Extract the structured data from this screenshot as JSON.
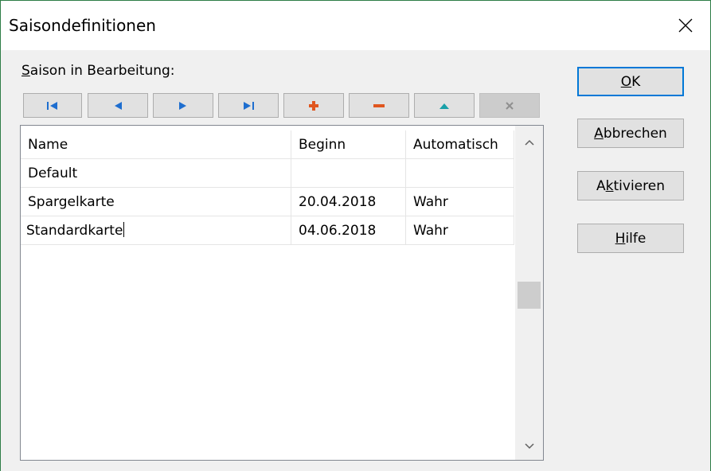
{
  "window": {
    "title": "Saisondefinitionen"
  },
  "label_saison": "Saison in Bearbeitung:",
  "nav_buttons": [
    {
      "name": "first-record",
      "icon": "first-record-icon",
      "color": "#1e6ecf",
      "enabled": true
    },
    {
      "name": "prior-record",
      "icon": "prior-record-icon",
      "color": "#1e6ecf",
      "enabled": true
    },
    {
      "name": "next-record",
      "icon": "next-record-icon",
      "color": "#1e6ecf",
      "enabled": true
    },
    {
      "name": "last-record",
      "icon": "last-record-icon",
      "color": "#1e6ecf",
      "enabled": true
    },
    {
      "name": "insert-record",
      "icon": "plus-icon",
      "color": "#e0561f",
      "enabled": true
    },
    {
      "name": "delete-record",
      "icon": "minus-icon",
      "color": "#e0561f",
      "enabled": true
    },
    {
      "name": "edit-record",
      "icon": "triangle-up-icon",
      "color": "#1aa0a8",
      "enabled": true
    },
    {
      "name": "cancel-edit",
      "icon": "x-icon",
      "color": "#999999",
      "enabled": false
    }
  ],
  "grid": {
    "columns": [
      "Name",
      "Beginn",
      "Automatisch"
    ],
    "rows": [
      [
        "Default",
        "",
        ""
      ],
      [
        "Spargelkarte",
        "20.04.2018",
        "Wahr"
      ],
      [
        "Standardkarte",
        "04.06.2018",
        "Wahr"
      ]
    ]
  },
  "buttons": {
    "ok": {
      "pre": "",
      "accel": "O",
      "post": "K"
    },
    "cancel": {
      "pre": "",
      "accel": "A",
      "post": "bbrechen"
    },
    "activate": {
      "pre": "A",
      "accel": "k",
      "post": "tivieren"
    },
    "help": {
      "pre": "",
      "accel": "H",
      "post": "ilfe"
    }
  }
}
